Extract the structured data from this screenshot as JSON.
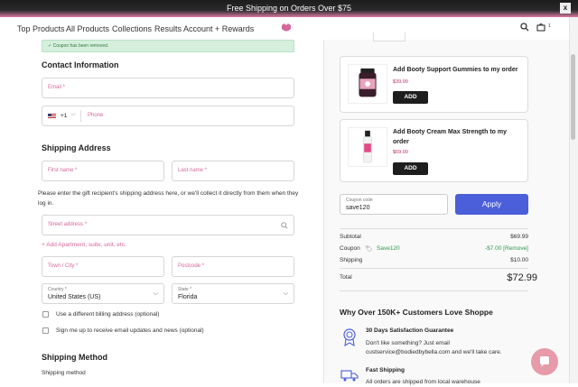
{
  "banner": {
    "text": "Free Shipping on Orders Over $75",
    "close": "x"
  },
  "nav": {
    "items": [
      "Top Products",
      "All Products",
      "Collections",
      "Results",
      "Account + Rewards"
    ],
    "cart_count": "1"
  },
  "notice": "Coupon has been removed.",
  "contact": {
    "heading": "Contact Information",
    "email_placeholder": "Email *",
    "phone_code": "+1",
    "phone_placeholder": "Phone"
  },
  "shipping": {
    "heading": "Shipping Address",
    "first_name": "First name *",
    "last_name": "Last name *",
    "note": "Please enter the gift recipient's shipping address here, or we'll collect it directly from them when they log in.",
    "street": "Street address *",
    "add_apartment": "+ Add Apartment, suite, unit, etc.",
    "town": "Town / City *",
    "postcode": "Postcode *",
    "country_label": "Country *",
    "country_value": "United States (US)",
    "state_label": "State *",
    "state_value": "Florida",
    "billing_checkbox": "Use a different billing address (optional)",
    "newsletter_checkbox": "Sign me up to receive email updates and news (optional)"
  },
  "shipping_method": {
    "heading": "Shipping Method",
    "label": "Shipping method"
  },
  "upsells": [
    {
      "title": "Add Booty Support Gummies to my order",
      "price": "$39.99",
      "button": "ADD"
    },
    {
      "title": "Add Booty Cream Max Strength to my order",
      "price": "$69.99",
      "button": "ADD"
    }
  ],
  "coupon": {
    "label": "Coupon code",
    "value": "save120",
    "apply": "Apply"
  },
  "summary": {
    "subtotal_label": "Subtotal",
    "subtotal": "$69.99",
    "coupon_label": "Coupon",
    "coupon_code": "Save120",
    "coupon_amount": "-$7.00 [Remove]",
    "shipping_label": "Shipping",
    "shipping": "$10.00",
    "total_label": "Total",
    "total": "$72.99"
  },
  "why": {
    "heading": "Why Over 150K+ Customers Love Shoppe",
    "perks": [
      {
        "title": "30 Days Satisfaction Guarantee",
        "text": "Don't like something? Just email custservice@bodiedbybella.com and we'll take care."
      },
      {
        "title": "Fast Shipping",
        "text": "All orders are shipped from local warehouse"
      }
    ]
  },
  "colors": {
    "accent_pink": "#d6679a",
    "apply_blue": "#4a5fd9",
    "notice_green": "#d6efdd"
  }
}
